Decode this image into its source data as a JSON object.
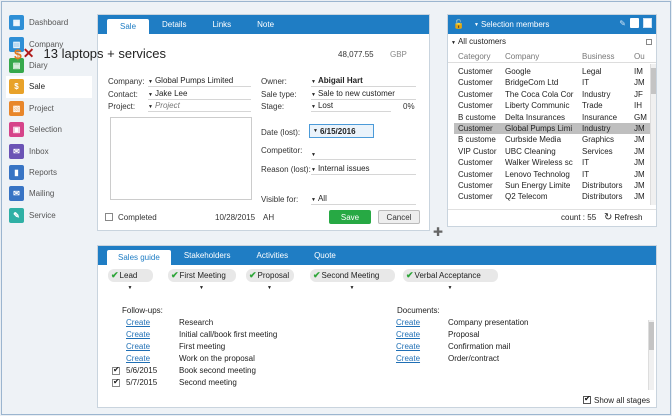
{
  "nav": {
    "items": [
      {
        "label": "Dashboard",
        "icon": "dashboard-icon",
        "color": "#2e8fd6"
      },
      {
        "label": "Company",
        "icon": "company-icon",
        "color": "#2e8fd6"
      },
      {
        "label": "Diary",
        "icon": "diary-icon",
        "color": "#36a84b"
      },
      {
        "label": "Sale",
        "icon": "sale-icon",
        "color": "#e8a22a"
      },
      {
        "label": "Project",
        "icon": "project-icon",
        "color": "#e8862a"
      },
      {
        "label": "Selection",
        "icon": "selection-icon",
        "color": "#d6448a"
      },
      {
        "label": "Inbox",
        "icon": "inbox-icon",
        "color": "#6b53b5"
      },
      {
        "label": "Reports",
        "icon": "reports-icon",
        "color": "#3874c4"
      },
      {
        "label": "Mailing",
        "icon": "mailing-icon",
        "color": "#3874c4"
      },
      {
        "label": "Service",
        "icon": "service-icon",
        "color": "#2fb0a5"
      }
    ],
    "active_index": 3
  },
  "sale": {
    "tabs": [
      "Sale",
      "Details",
      "Links",
      "Note"
    ],
    "title": "13 laptops + services",
    "amount": "48,077.55",
    "currency": "GBP",
    "company_label": "Company:",
    "company_value": "Global Pumps Limited",
    "contact_label": "Contact:",
    "contact_value": "Jake Lee",
    "project_label": "Project:",
    "project_value": "Project",
    "owner_label": "Owner:",
    "owner_value": "Abigail Hart",
    "saletype_label": "Sale type:",
    "saletype_value": "Sale to new customer",
    "stage_label": "Stage:",
    "stage_value": "Lost",
    "stage_percent": "0%",
    "date_label": "Date (lost):",
    "date_value": "6/15/2016",
    "competitor_label": "Competitor:",
    "reason_label": "Reason (lost):",
    "reason_value": "Internal issues",
    "visible_label": "Visible for:",
    "visible_value": "All",
    "completed_label": "Completed",
    "completed_date": "10/28/2015",
    "completed_user": "AH",
    "save_label": "Save",
    "cancel_label": "Cancel"
  },
  "selection": {
    "title": "Selection members",
    "filter": "All customers",
    "columns": [
      "Category",
      "Company",
      "Business",
      "Ou"
    ],
    "rows": [
      [
        "Customer",
        "Google",
        "Legal",
        "IM"
      ],
      [
        "Customer",
        "BridgeCom Ltd",
        "IT",
        "JM"
      ],
      [
        "Customer",
        "The Coca Cola Cor",
        "Industry",
        "JF"
      ],
      [
        "Customer",
        "Liberty Communic",
        "Trade",
        "IH"
      ],
      [
        "B custome",
        "Delta Insurances",
        "Insurance",
        "GM"
      ],
      [
        "Customer",
        "Global Pumps Limi",
        "Industry",
        "JM"
      ],
      [
        "B custome",
        "Curbside Media",
        "Graphics",
        "JM"
      ],
      [
        "VIP Custor",
        "UBC Cleaning",
        "Services",
        "JM"
      ],
      [
        "Customer",
        "Walker Wireless sc",
        "IT",
        "JM"
      ],
      [
        "Customer",
        "Lenovo Technolog",
        "IT",
        "JM"
      ],
      [
        "Customer",
        "Sun Energy Limite",
        "Distributors",
        "JM"
      ],
      [
        "Customer",
        "Q2 Telecom",
        "Distributors",
        "JM"
      ]
    ],
    "selected_index": 5,
    "count_text": "count : 55",
    "refresh_label": "Refresh"
  },
  "guide": {
    "tabs": [
      "Sales guide",
      "Stakeholders",
      "Activities",
      "Quote"
    ],
    "stages": [
      "Lead",
      "First Meeting",
      "Proposal",
      "Second Meeting",
      "Verbal Acceptance"
    ],
    "followups_label": "Follow-ups:",
    "documents_label": "Documents:",
    "followups": [
      {
        "status": "Create",
        "text": "Research",
        "checked": false
      },
      {
        "status": "Create",
        "text": "Initial call/book first meeting",
        "checked": false
      },
      {
        "status": "Create",
        "text": "First meeting",
        "checked": false
      },
      {
        "status": "Create",
        "text": "Work on the proposal",
        "checked": false
      },
      {
        "status": "5/6/2015",
        "text": "Book second meeting",
        "checked": true
      },
      {
        "status": "5/7/2015",
        "text": "Second meeting",
        "checked": true
      }
    ],
    "documents": [
      {
        "status": "Create",
        "text": "Company presentation"
      },
      {
        "status": "Create",
        "text": "Proposal"
      },
      {
        "status": "Create",
        "text": "Confirmation mail"
      },
      {
        "status": "Create",
        "text": "Order/contract"
      }
    ],
    "show_all_label": "Show all stages"
  }
}
